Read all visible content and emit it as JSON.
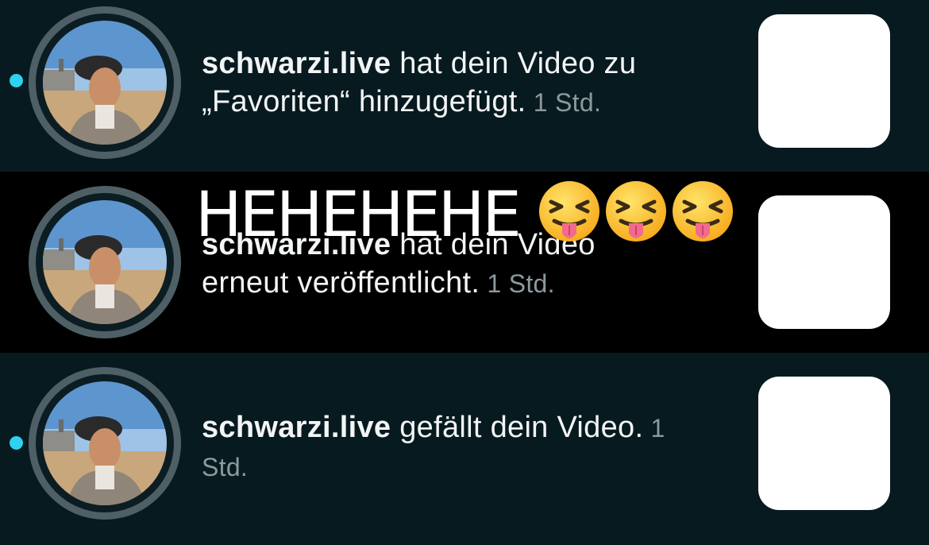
{
  "notifications": [
    {
      "username": "schwarzi.live",
      "line1_rest": " hat dein Video zu",
      "line2": "„Favoriten“ hinzugefügt.",
      "time": " 1 Std.",
      "unread": true
    },
    {
      "username": "schwarzi.live",
      "line1_rest": " hat dein Video",
      "line2": "erneut veröffentlicht.",
      "time": " 1 Std.",
      "unread": false
    },
    {
      "username": "schwarzi.live",
      "line1_rest": " gefällt dein Video.",
      "line1_time": " 1",
      "line2": "Std.",
      "unread": true
    }
  ],
  "overlay": {
    "caption": "HEHEHEHE",
    "emoji": [
      "squinting-face-with-tongue",
      "squinting-face-with-tongue",
      "squinting-face-with-tongue"
    ]
  },
  "colors": {
    "background": "#071a1f",
    "highlight_row": "#000000",
    "unread_dot": "#2fd0f0",
    "ring": "#4e6066",
    "thumbnail": "#ffffff"
  }
}
